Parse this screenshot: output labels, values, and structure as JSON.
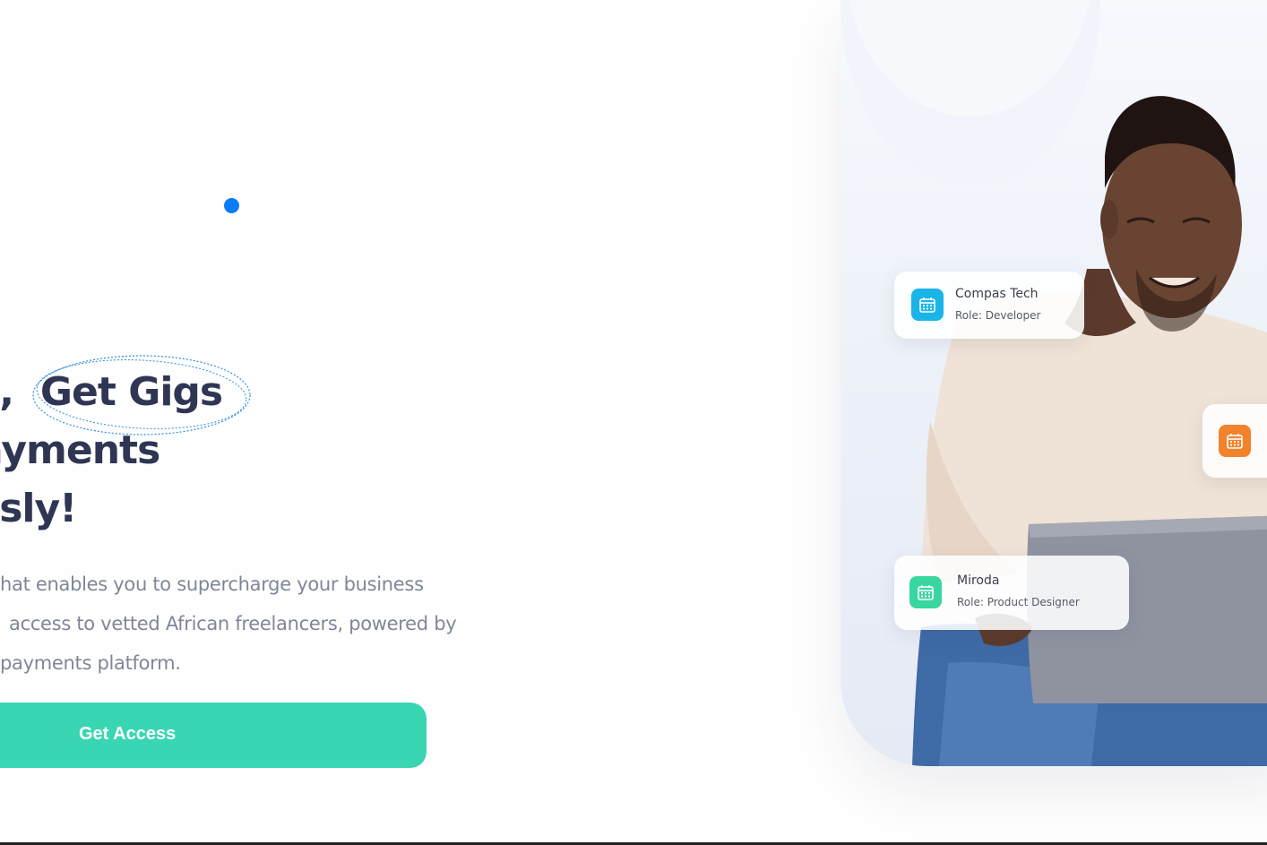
{
  "hero": {
    "headline": {
      "line1_prefix": "s,",
      "line1_highlight": "Get Gigs",
      "line2": "ayments",
      "line3": "ssly!"
    },
    "subtext": {
      "line1": "hat enables you to supercharge your business",
      "line2": "access to vetted African freelancers, powered by",
      "line3": "payments platform."
    },
    "cta_label": "Get Access"
  },
  "cards": [
    {
      "title": "Compas Tech",
      "role": "Role: Developer",
      "icon": "calendar-icon",
      "color": "#1ab4e8"
    },
    {
      "title": "Miroda",
      "role": "Role: Product Designer",
      "icon": "calendar-icon",
      "color": "#3ad6a0"
    },
    {
      "title": "",
      "role": "",
      "icon": "calendar-icon",
      "color": "#f2822c"
    }
  ],
  "colors": {
    "heading": "#2f3654",
    "body_text": "#7e8798",
    "cta": "#3ad6b3",
    "accent_dot": "#0a7cf5",
    "curve": "#4fb8c9"
  }
}
